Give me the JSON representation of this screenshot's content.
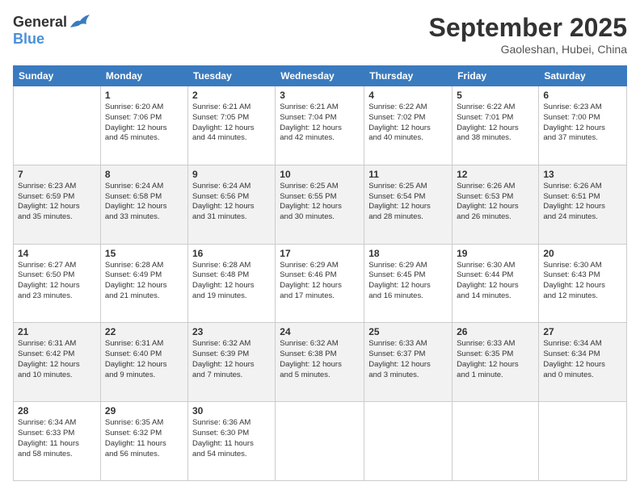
{
  "header": {
    "logo": {
      "general": "General",
      "blue": "Blue"
    },
    "title": "September 2025",
    "location": "Gaoleshan, Hubei, China"
  },
  "calendar": {
    "days_of_week": [
      "Sunday",
      "Monday",
      "Tuesday",
      "Wednesday",
      "Thursday",
      "Friday",
      "Saturday"
    ],
    "weeks": [
      [
        {
          "day": "",
          "info": ""
        },
        {
          "day": "1",
          "info": "Sunrise: 6:20 AM\nSunset: 7:06 PM\nDaylight: 12 hours\nand 45 minutes."
        },
        {
          "day": "2",
          "info": "Sunrise: 6:21 AM\nSunset: 7:05 PM\nDaylight: 12 hours\nand 44 minutes."
        },
        {
          "day": "3",
          "info": "Sunrise: 6:21 AM\nSunset: 7:04 PM\nDaylight: 12 hours\nand 42 minutes."
        },
        {
          "day": "4",
          "info": "Sunrise: 6:22 AM\nSunset: 7:02 PM\nDaylight: 12 hours\nand 40 minutes."
        },
        {
          "day": "5",
          "info": "Sunrise: 6:22 AM\nSunset: 7:01 PM\nDaylight: 12 hours\nand 38 minutes."
        },
        {
          "day": "6",
          "info": "Sunrise: 6:23 AM\nSunset: 7:00 PM\nDaylight: 12 hours\nand 37 minutes."
        }
      ],
      [
        {
          "day": "7",
          "info": "Sunrise: 6:23 AM\nSunset: 6:59 PM\nDaylight: 12 hours\nand 35 minutes."
        },
        {
          "day": "8",
          "info": "Sunrise: 6:24 AM\nSunset: 6:58 PM\nDaylight: 12 hours\nand 33 minutes."
        },
        {
          "day": "9",
          "info": "Sunrise: 6:24 AM\nSunset: 6:56 PM\nDaylight: 12 hours\nand 31 minutes."
        },
        {
          "day": "10",
          "info": "Sunrise: 6:25 AM\nSunset: 6:55 PM\nDaylight: 12 hours\nand 30 minutes."
        },
        {
          "day": "11",
          "info": "Sunrise: 6:25 AM\nSunset: 6:54 PM\nDaylight: 12 hours\nand 28 minutes."
        },
        {
          "day": "12",
          "info": "Sunrise: 6:26 AM\nSunset: 6:53 PM\nDaylight: 12 hours\nand 26 minutes."
        },
        {
          "day": "13",
          "info": "Sunrise: 6:26 AM\nSunset: 6:51 PM\nDaylight: 12 hours\nand 24 minutes."
        }
      ],
      [
        {
          "day": "14",
          "info": "Sunrise: 6:27 AM\nSunset: 6:50 PM\nDaylight: 12 hours\nand 23 minutes."
        },
        {
          "day": "15",
          "info": "Sunrise: 6:28 AM\nSunset: 6:49 PM\nDaylight: 12 hours\nand 21 minutes."
        },
        {
          "day": "16",
          "info": "Sunrise: 6:28 AM\nSunset: 6:48 PM\nDaylight: 12 hours\nand 19 minutes."
        },
        {
          "day": "17",
          "info": "Sunrise: 6:29 AM\nSunset: 6:46 PM\nDaylight: 12 hours\nand 17 minutes."
        },
        {
          "day": "18",
          "info": "Sunrise: 6:29 AM\nSunset: 6:45 PM\nDaylight: 12 hours\nand 16 minutes."
        },
        {
          "day": "19",
          "info": "Sunrise: 6:30 AM\nSunset: 6:44 PM\nDaylight: 12 hours\nand 14 minutes."
        },
        {
          "day": "20",
          "info": "Sunrise: 6:30 AM\nSunset: 6:43 PM\nDaylight: 12 hours\nand 12 minutes."
        }
      ],
      [
        {
          "day": "21",
          "info": "Sunrise: 6:31 AM\nSunset: 6:42 PM\nDaylight: 12 hours\nand 10 minutes."
        },
        {
          "day": "22",
          "info": "Sunrise: 6:31 AM\nSunset: 6:40 PM\nDaylight: 12 hours\nand 9 minutes."
        },
        {
          "day": "23",
          "info": "Sunrise: 6:32 AM\nSunset: 6:39 PM\nDaylight: 12 hours\nand 7 minutes."
        },
        {
          "day": "24",
          "info": "Sunrise: 6:32 AM\nSunset: 6:38 PM\nDaylight: 12 hours\nand 5 minutes."
        },
        {
          "day": "25",
          "info": "Sunrise: 6:33 AM\nSunset: 6:37 PM\nDaylight: 12 hours\nand 3 minutes."
        },
        {
          "day": "26",
          "info": "Sunrise: 6:33 AM\nSunset: 6:35 PM\nDaylight: 12 hours\nand 1 minute."
        },
        {
          "day": "27",
          "info": "Sunrise: 6:34 AM\nSunset: 6:34 PM\nDaylight: 12 hours\nand 0 minutes."
        }
      ],
      [
        {
          "day": "28",
          "info": "Sunrise: 6:34 AM\nSunset: 6:33 PM\nDaylight: 11 hours\nand 58 minutes."
        },
        {
          "day": "29",
          "info": "Sunrise: 6:35 AM\nSunset: 6:32 PM\nDaylight: 11 hours\nand 56 minutes."
        },
        {
          "day": "30",
          "info": "Sunrise: 6:36 AM\nSunset: 6:30 PM\nDaylight: 11 hours\nand 54 minutes."
        },
        {
          "day": "",
          "info": ""
        },
        {
          "day": "",
          "info": ""
        },
        {
          "day": "",
          "info": ""
        },
        {
          "day": "",
          "info": ""
        }
      ]
    ]
  }
}
